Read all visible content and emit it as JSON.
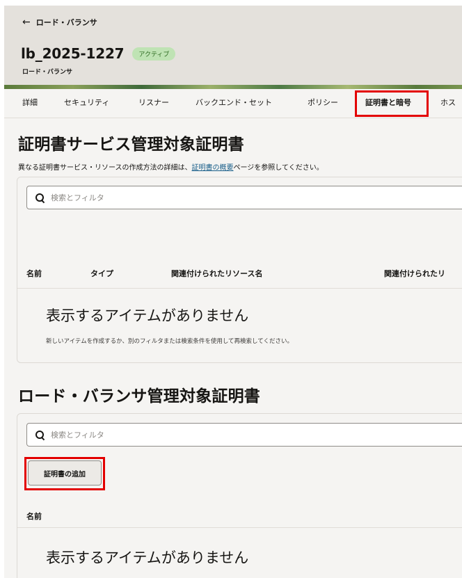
{
  "header": {
    "back_label": "ロード・バランサ",
    "title": "lb_2025-1227",
    "status": "アクティブ",
    "subtitle": "ロード・バランサ"
  },
  "tabs": [
    {
      "label": "詳細"
    },
    {
      "label": "セキュリティ"
    },
    {
      "label": "リスナー"
    },
    {
      "label": "バックエンド・セット"
    },
    {
      "label": "ポリシー"
    },
    {
      "label": "証明書と暗号",
      "active": true
    },
    {
      "label": "ホス"
    }
  ],
  "section1": {
    "title": "証明書サービス管理対象証明書",
    "desc_before": "異なる証明書サービス・リソースの作成方法の詳細は、",
    "desc_link": "証明書の概要",
    "desc_after": "ページを参照してください。",
    "search_placeholder": "検索とフィルタ",
    "columns": [
      "名前",
      "タイプ",
      "関連付けられたリソース名",
      "関連付けられたリ"
    ],
    "empty_title": "表示するアイテムがありません",
    "empty_sub": "新しいアイテムを作成するか、別のフィルタまたは検索条件を使用して再検索してください。"
  },
  "section2": {
    "title": "ロード・バランサ管理対象証明書",
    "search_placeholder": "検索とフィルタ",
    "add_button": "証明書の追加",
    "columns": [
      "名前"
    ],
    "empty_title": "表示するアイテムがありません"
  },
  "colors": {
    "highlight": "#e30000",
    "status_badge_bg": "#bfe3b4",
    "link": "#1a5f8a"
  }
}
